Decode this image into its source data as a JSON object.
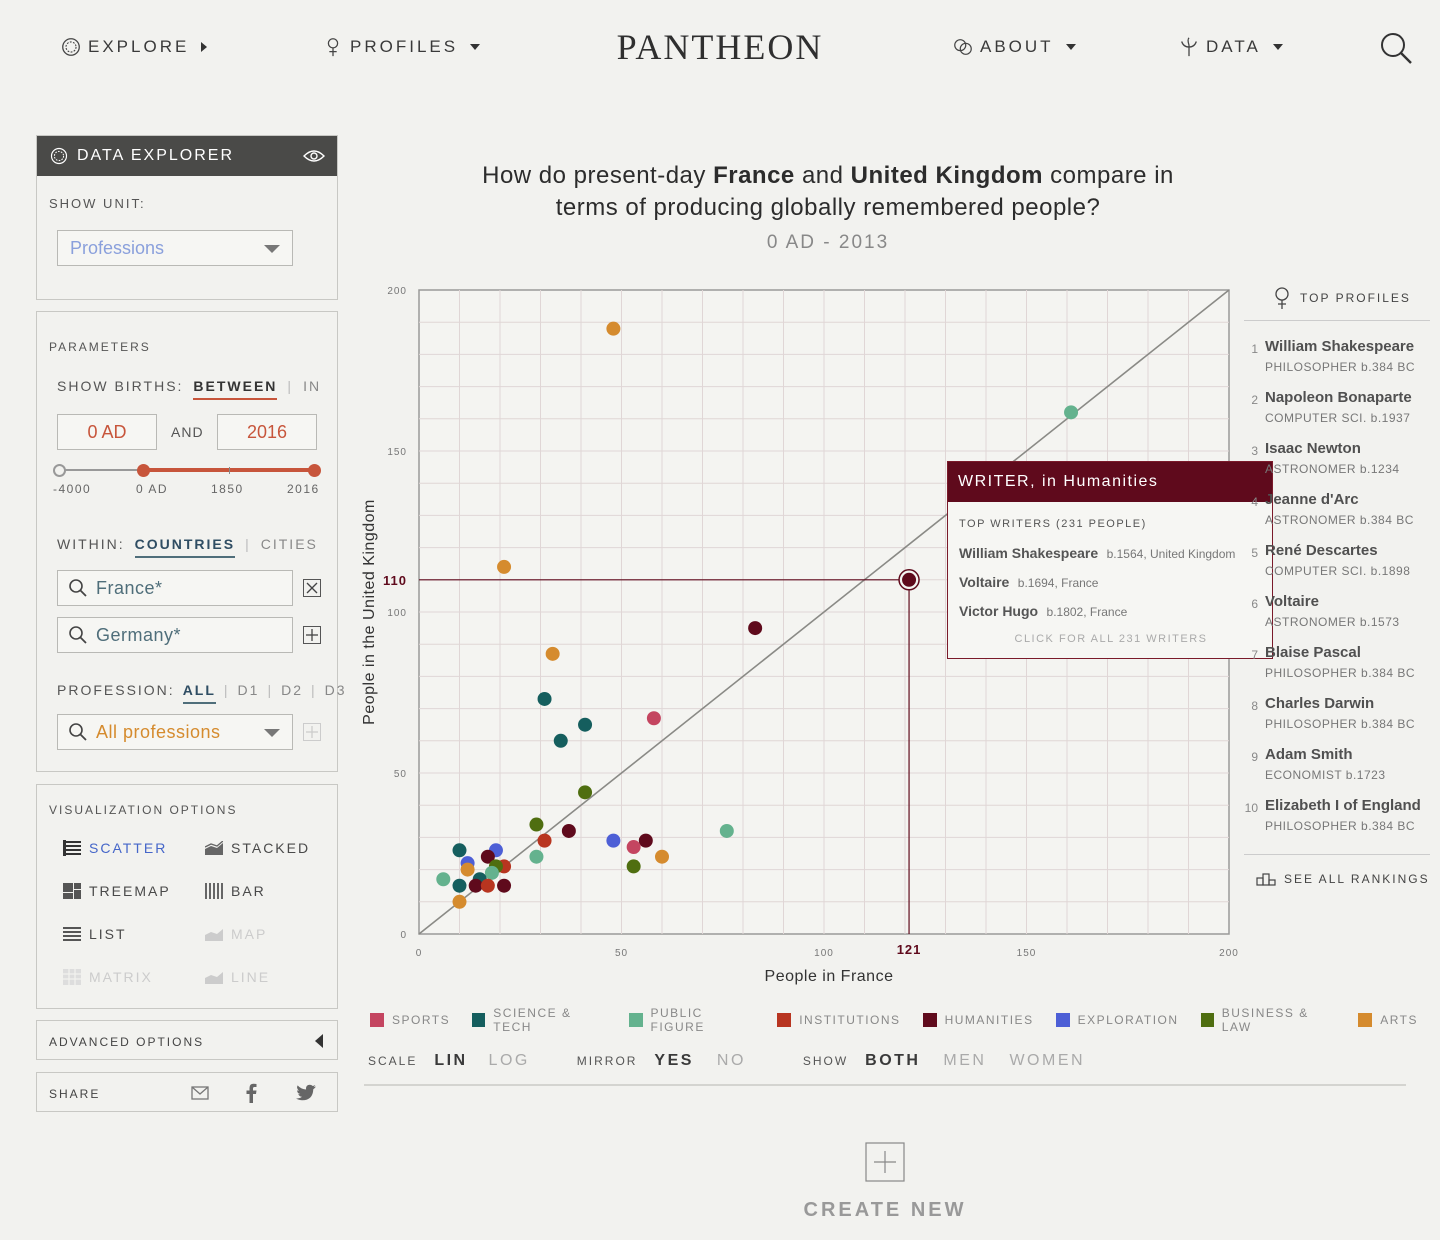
{
  "nav": {
    "explore": "EXPLORE",
    "profiles": "PROFILES",
    "logo": "PANTHEON",
    "about": "ABOUT",
    "data": "DATA"
  },
  "panel": {
    "title": "DATA EXPLORER",
    "show_unit_label": "SHOW UNIT:",
    "show_unit_value": "Professions",
    "parameters_label": "PARAMETERS",
    "show_births_label": "SHOW BIRTHS:",
    "between": "BETWEEN",
    "in": "IN",
    "from_value": "0 AD",
    "and": "AND",
    "to_value": "2016",
    "slider_ticks": [
      "-4000",
      "0 AD",
      "1850",
      "2016"
    ],
    "within_label": "WITHIN:",
    "countries": "COUNTRIES",
    "cities": "CITIES",
    "country_1": "France*",
    "country_2": "Germany*",
    "profession_label": "PROFESSION:",
    "prof_all": "ALL",
    "prof_d1": "D1",
    "prof_d2": "D2",
    "prof_d3": "D3",
    "profession_value": "All professions",
    "viz_label": "VISUALIZATION OPTIONS",
    "viz": {
      "scatter": "SCATTER",
      "stacked": "STACKED",
      "treemap": "TREEMAP",
      "bar": "BAR",
      "list": "LIST",
      "map": "MAP",
      "matrix": "MATRIX",
      "line": "LINE"
    },
    "advanced": "ADVANCED OPTIONS",
    "share": "SHARE"
  },
  "chart": {
    "title_pre": "How do present-day ",
    "title_c1": "France",
    "title_mid": " and ",
    "title_c2": "United Kingdom",
    "title_post": " compare in",
    "title_line2": "terms of producing globally remembered people?",
    "range": "0 AD - 2013"
  },
  "chart_data": {
    "type": "scatter",
    "xlabel": "People in France",
    "ylabel": "People in the United Kingdom",
    "xlim": [
      0,
      200
    ],
    "ylim": [
      0,
      200
    ],
    "xticks": [
      0,
      50,
      100,
      150,
      200
    ],
    "yticks": [
      0,
      50,
      100,
      150,
      200
    ],
    "diagonal": true,
    "highlight": {
      "x": 121,
      "y": 110,
      "x_label": "121",
      "y_label": "110"
    },
    "categories": {
      "SPORTS": "#c44560",
      "SCIENCE & TECH": "#155e5e",
      "PUBLIC FIGURE": "#64b28e",
      "INSTITUTIONS": "#b83520",
      "HUMANITIES": "#5f0a1c",
      "EXPLORATION": "#4d5fd6",
      "BUSINESS & LAW": "#4f6e10",
      "ARTS": "#d58b2e"
    },
    "points": [
      {
        "x": 48,
        "y": 188,
        "c": "ARTS"
      },
      {
        "x": 161,
        "y": 162,
        "c": "PUBLIC FIGURE"
      },
      {
        "x": 21,
        "y": 114,
        "c": "ARTS"
      },
      {
        "x": 121,
        "y": 110,
        "c": "HUMANITIES"
      },
      {
        "x": 83,
        "y": 95,
        "c": "HUMANITIES"
      },
      {
        "x": 33,
        "y": 87,
        "c": "ARTS"
      },
      {
        "x": 31,
        "y": 73,
        "c": "SCIENCE & TECH"
      },
      {
        "x": 58,
        "y": 67,
        "c": "SPORTS"
      },
      {
        "x": 41,
        "y": 65,
        "c": "SCIENCE & TECH"
      },
      {
        "x": 35,
        "y": 60,
        "c": "SCIENCE & TECH"
      },
      {
        "x": 41,
        "y": 44,
        "c": "BUSINESS & LAW"
      },
      {
        "x": 76,
        "y": 32,
        "c": "PUBLIC FIGURE"
      },
      {
        "x": 29,
        "y": 34,
        "c": "BUSINESS & LAW"
      },
      {
        "x": 37,
        "y": 32,
        "c": "HUMANITIES"
      },
      {
        "x": 48,
        "y": 29,
        "c": "EXPLORATION"
      },
      {
        "x": 31,
        "y": 29,
        "c": "INSTITUTIONS"
      },
      {
        "x": 56,
        "y": 29,
        "c": "HUMANITIES"
      },
      {
        "x": 53,
        "y": 27,
        "c": "SPORTS"
      },
      {
        "x": 60,
        "y": 24,
        "c": "ARTS"
      },
      {
        "x": 29,
        "y": 24,
        "c": "PUBLIC FIGURE"
      },
      {
        "x": 53,
        "y": 21,
        "c": "BUSINESS & LAW"
      },
      {
        "x": 10,
        "y": 26,
        "c": "SCIENCE & TECH"
      },
      {
        "x": 19,
        "y": 26,
        "c": "EXPLORATION"
      },
      {
        "x": 17,
        "y": 24,
        "c": "HUMANITIES"
      },
      {
        "x": 12,
        "y": 22,
        "c": "EXPLORATION"
      },
      {
        "x": 21,
        "y": 21,
        "c": "INSTITUTIONS"
      },
      {
        "x": 19,
        "y": 21,
        "c": "BUSINESS & LAW"
      },
      {
        "x": 12,
        "y": 20,
        "c": "ARTS"
      },
      {
        "x": 18,
        "y": 19,
        "c": "PUBLIC FIGURE"
      },
      {
        "x": 6,
        "y": 17,
        "c": "PUBLIC FIGURE"
      },
      {
        "x": 15,
        "y": 17,
        "c": "SCIENCE & TECH"
      },
      {
        "x": 10,
        "y": 15,
        "c": "SCIENCE & TECH"
      },
      {
        "x": 14,
        "y": 15,
        "c": "HUMANITIES"
      },
      {
        "x": 17,
        "y": 15,
        "c": "INSTITUTIONS"
      },
      {
        "x": 21,
        "y": 15,
        "c": "HUMANITIES"
      },
      {
        "x": 10,
        "y": 10,
        "c": "ARTS"
      }
    ]
  },
  "tooltip": {
    "title": "WRITER, in Humanities",
    "subtitle": "TOP WRITERS (231 PEOPLE)",
    "people": [
      {
        "name": "William Shakespeare",
        "meta": "b.1564, United Kingdom"
      },
      {
        "name": "Voltaire",
        "meta": "b.1694, France"
      },
      {
        "name": "Victor Hugo",
        "meta": "b.1802, France"
      }
    ],
    "link": "CLICK FOR ALL 231 WRITERS"
  },
  "top_profiles": {
    "title": "TOP PROFILES",
    "items": [
      {
        "rank": "1",
        "name": "William Shakespeare",
        "sub": "PHILOSOPHER b.384 BC"
      },
      {
        "rank": "2",
        "name": "Napoleon Bonaparte",
        "sub": "COMPUTER SCI. b.1937"
      },
      {
        "rank": "3",
        "name": "Isaac Newton",
        "sub": "ASTRONOMER b.1234"
      },
      {
        "rank": "4",
        "name": "Jeanne d'Arc",
        "sub": "ASTRONOMER b.384 BC"
      },
      {
        "rank": "5",
        "name": "René Descartes",
        "sub": "COMPUTER SCI. b.1898"
      },
      {
        "rank": "6",
        "name": "Voltaire",
        "sub": "ASTRONOMER b.1573"
      },
      {
        "rank": "7",
        "name": "Blaise Pascal",
        "sub": "PHILOSOPHER b.384 BC"
      },
      {
        "rank": "8",
        "name": "Charles Darwin",
        "sub": "PHILOSOPHER b.384 BC"
      },
      {
        "rank": "9",
        "name": "Adam Smith",
        "sub": "ECONOMIST b.1723"
      },
      {
        "rank": "10",
        "name": "Elizabeth I of England",
        "sub": "PHILOSOPHER b.384 BC"
      }
    ],
    "see_all": "SEE ALL RANKINGS"
  },
  "legend": [
    "SPORTS",
    "SCIENCE & TECH",
    "PUBLIC FIGURE",
    "INSTITUTIONS",
    "HUMANITIES",
    "EXPLORATION",
    "BUSINESS & LAW",
    "ARTS"
  ],
  "controls": {
    "scale": "SCALE",
    "lin": "LIN",
    "log": "LOG",
    "mirror": "MIRROR",
    "yes": "YES",
    "no": "NO",
    "show": "SHOW",
    "both": "BOTH",
    "men": "MEN",
    "women": "WOMEN"
  },
  "create_new": "CREATE NEW",
  "colors": {
    "accent": "#c7553b",
    "link_blue": "#4f6e7a",
    "dark_red": "#5f0a1c",
    "orange": "#d58b2e"
  }
}
